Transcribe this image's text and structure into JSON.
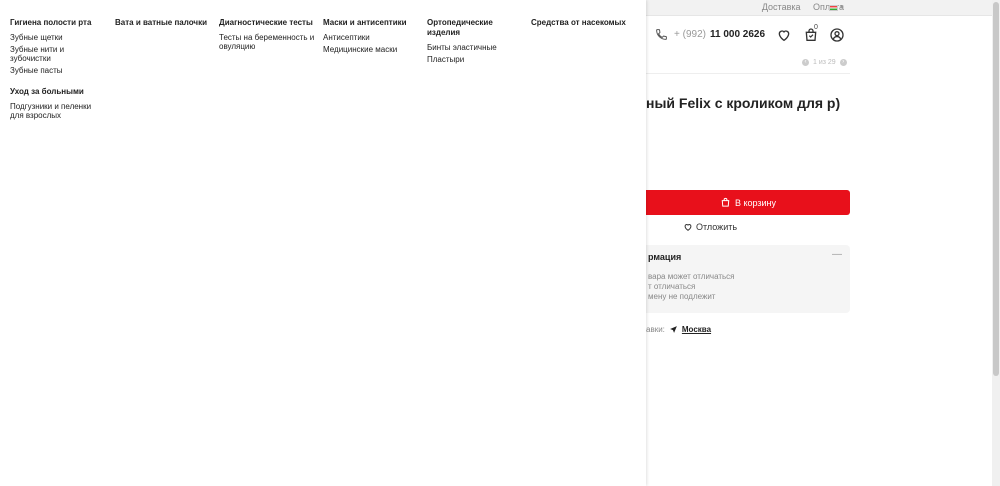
{
  "topbar": {
    "links": [
      "Доставка",
      "Оплата"
    ]
  },
  "header": {
    "phone_prefix": "+ (992)",
    "phone_number": "11 000 2626",
    "cart_count": "0",
    "icons": [
      "phone-icon",
      "heart-icon",
      "cart-icon",
      "user-icon"
    ]
  },
  "gallery": {
    "counter": "1 из 29"
  },
  "product": {
    "title": "ный Felix с кроликом для р)",
    "cart_button": "В корзину",
    "later": "Отложить",
    "info": {
      "title": "рмация",
      "lines": [
        "вара может отличаться",
        "т отличаться",
        "мену не подлежит"
      ]
    },
    "shipping_label": "авки:",
    "shipping_city": "Москва"
  },
  "menu": {
    "columns": [
      {
        "groups": [
          {
            "title": "Гигиена полости рта",
            "items": [
              "Зубные щетки",
              "Зубные нити и зубочистки",
              "Зубные пасты"
            ]
          },
          {
            "title": "Уход за больными",
            "items": [
              "Подгузники и пеленки для взрослых"
            ]
          }
        ]
      },
      {
        "groups": [
          {
            "title": "Вата и ватные палочки",
            "items": []
          }
        ]
      },
      {
        "groups": [
          {
            "title": "Диагностические тесты",
            "items": [
              "Тесты на беременность и овуляцию"
            ]
          }
        ]
      },
      {
        "groups": [
          {
            "title": "Маски и антисептики",
            "items": [
              "Антисептики",
              "Медицинские маски"
            ]
          }
        ]
      },
      {
        "groups": [
          {
            "title": "Ортопедические изделия",
            "items": [
              "Бинты эластичные",
              "Пластыри"
            ]
          }
        ]
      },
      {
        "groups": [
          {
            "title": "Средства от насекомых",
            "items": []
          }
        ]
      }
    ]
  },
  "colors": {
    "accent": "#e8101b"
  }
}
